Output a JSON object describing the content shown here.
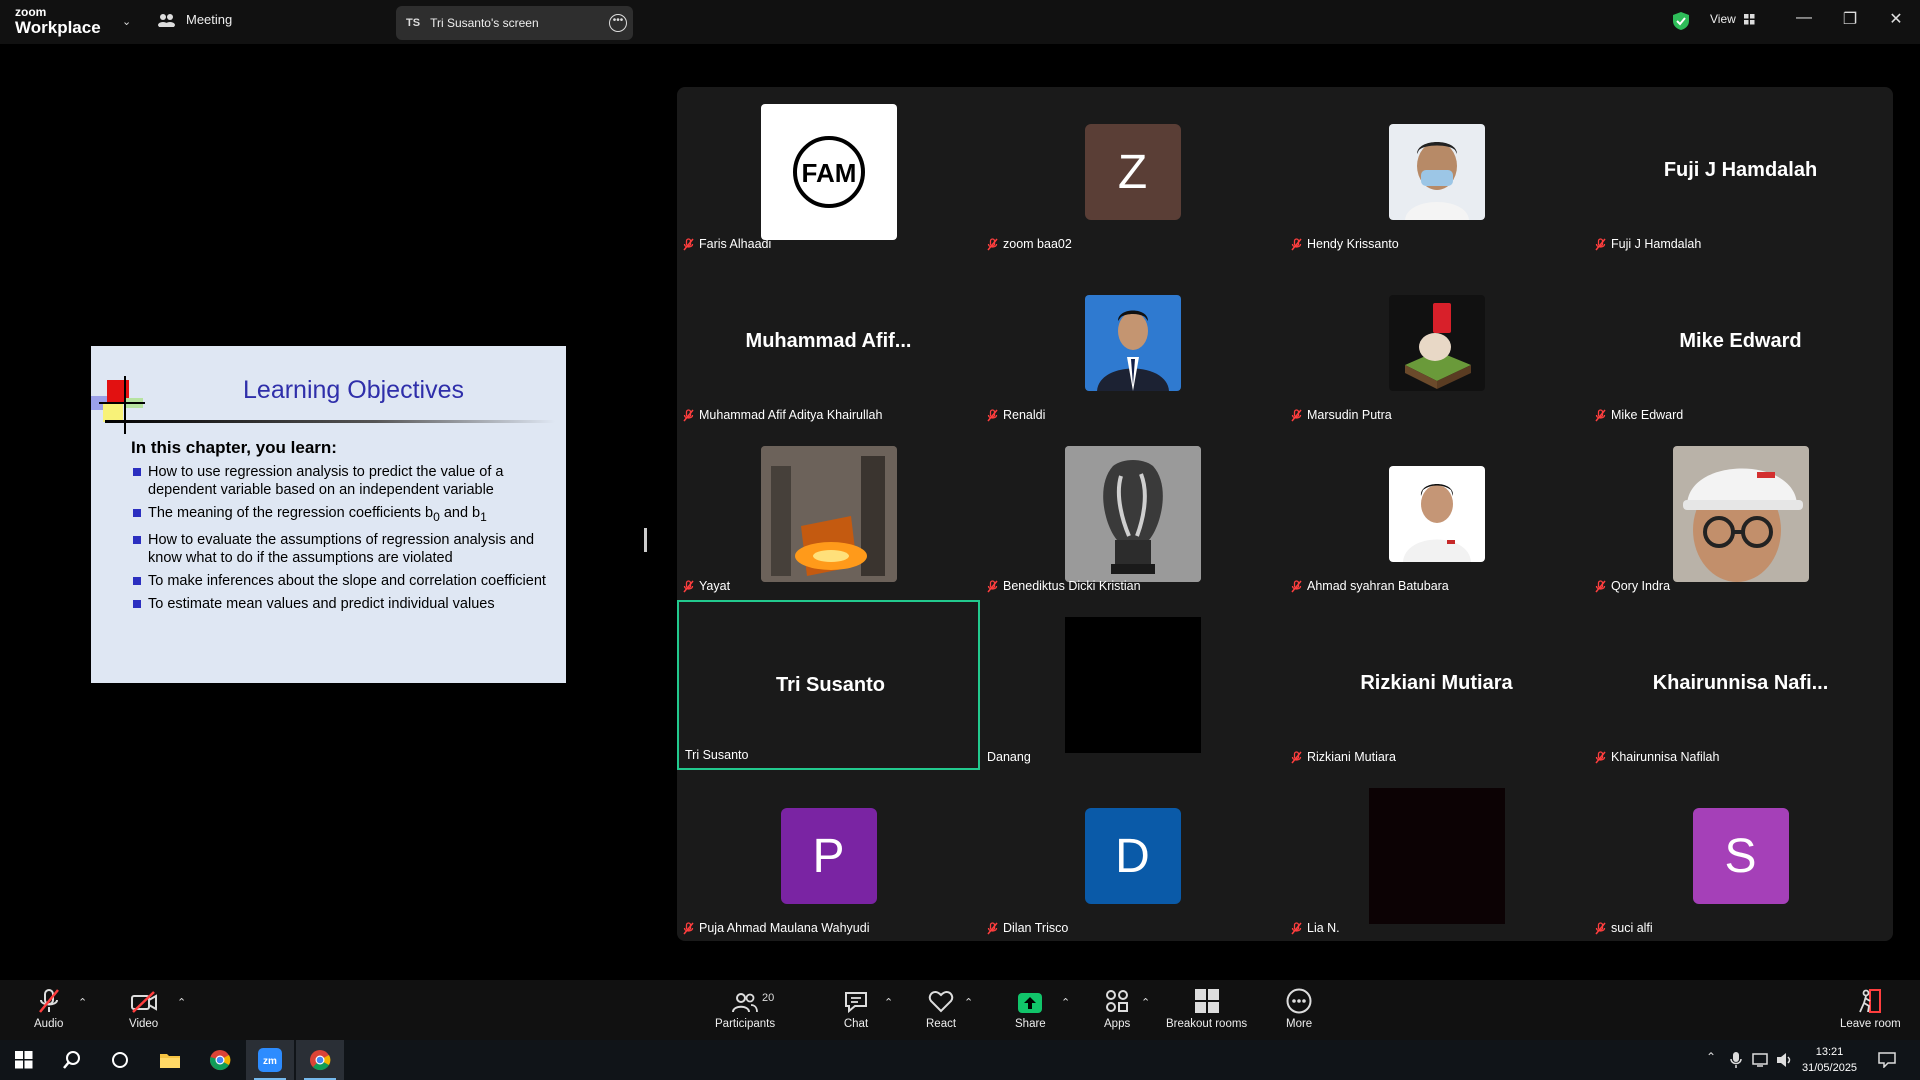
{
  "app": {
    "brand_top": "zoom",
    "brand_main": "Workplace",
    "meeting_label": "Meeting"
  },
  "share": {
    "initials": "TS",
    "title": "Tri Susanto's screen"
  },
  "header": {
    "view_label": "View"
  },
  "slide": {
    "title": "Learning Objectives",
    "subtitle": "In this chapter, you learn:",
    "bullets": [
      "How to use regression analysis to predict the value of a dependent variable based on an independent variable",
      "The meaning of the regression coefficients b",
      "How to evaluate the assumptions of regression analysis and know what to do if the assumptions are violated",
      "To make inferences about the slope and correlation coefficient",
      "To estimate mean values and predict individual values"
    ],
    "sub0": "0",
    "and": " and b",
    "sub1": "1"
  },
  "participants": [
    {
      "name": "Faris Alhaadi",
      "muted": true,
      "kind": "fam",
      "logo_text": "FAM"
    },
    {
      "name": "zoom baa02",
      "muted": true,
      "kind": "letter",
      "letter": "Z",
      "color": "#5a3e36"
    },
    {
      "name": "Hendy Krissanto",
      "muted": true,
      "kind": "photo-mask"
    },
    {
      "name": "Fuji J Hamdalah",
      "muted": true,
      "kind": "name",
      "display": "Fuji J Hamdalah"
    },
    {
      "name": "Muhammad Afif Aditya Khairullah",
      "muted": true,
      "kind": "name",
      "display": "Muhammad  Afif..."
    },
    {
      "name": "Renaldi",
      "muted": true,
      "kind": "photo-suit"
    },
    {
      "name": "Marsudin Putra",
      "muted": true,
      "kind": "photo-hand"
    },
    {
      "name": "Mike Edward",
      "muted": true,
      "kind": "name",
      "display": "Mike Edward"
    },
    {
      "name": "Yayat",
      "muted": true,
      "kind": "photo-steel"
    },
    {
      "name": "Benediktus Dicki Kristian",
      "muted": true,
      "kind": "photo-trophy"
    },
    {
      "name": "Ahmad syahran Batubara",
      "muted": true,
      "kind": "photo-boy"
    },
    {
      "name": "Qory Indra",
      "muted": true,
      "kind": "photo-helmet"
    },
    {
      "name": "Tri Susanto",
      "muted": false,
      "kind": "name",
      "display": "Tri Susanto",
      "active": true
    },
    {
      "name": "Danang",
      "muted": false,
      "kind": "black"
    },
    {
      "name": "Rizkiani Mutiara",
      "muted": true,
      "kind": "name",
      "display": "Rizkiani Mutiara"
    },
    {
      "name": "Khairunnisa Nafilah",
      "muted": true,
      "kind": "name",
      "display": "Khairunnisa  Nafi..."
    },
    {
      "name": "Puja Ahmad Maulana Wahyudi",
      "muted": true,
      "kind": "letter",
      "letter": "P",
      "color": "#7a24a3"
    },
    {
      "name": "Dilan Trisco",
      "muted": true,
      "kind": "letter",
      "letter": "D",
      "color": "#0a5aa8"
    },
    {
      "name": "Lia N.",
      "muted": true,
      "kind": "darkred"
    },
    {
      "name": "suci alfi",
      "muted": true,
      "kind": "letter",
      "letter": "S",
      "color": "#a540b8"
    }
  ],
  "toolbar": {
    "audio": "Audio",
    "video": "Video",
    "participants": "Participants",
    "participants_count": "20",
    "chat": "Chat",
    "react": "React",
    "share": "Share",
    "apps": "Apps",
    "breakout": "Breakout rooms",
    "more": "More",
    "leave": "Leave room"
  },
  "clock": {
    "time": "13:21",
    "date": "31/05/2025"
  },
  "colors": {
    "accent": "#22c98e",
    "share_green": "#11c46a",
    "muted_red": "#ff3e3e"
  }
}
